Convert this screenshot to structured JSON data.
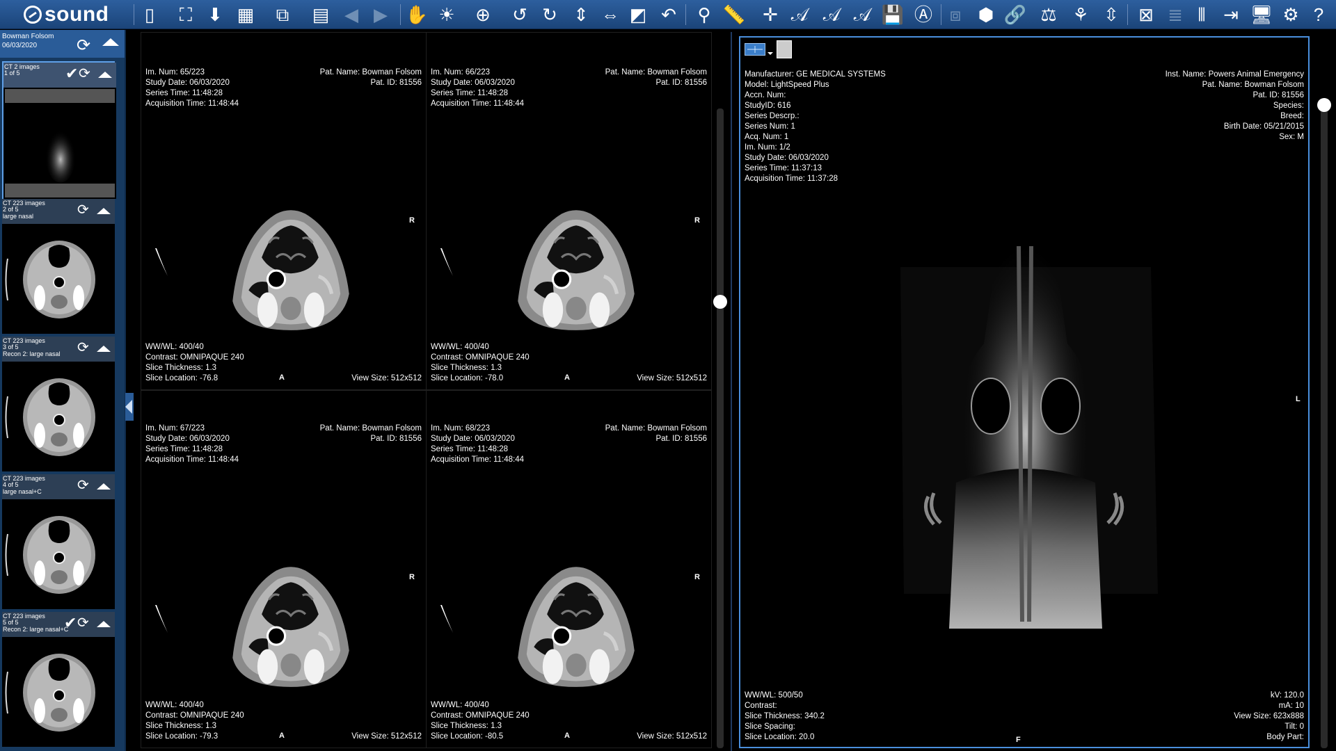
{
  "app": {
    "logo_text": "sound",
    "logo_mark": "sound-logo-mark"
  },
  "toolbar": {
    "icons": [
      "layout-1x1-icon",
      "fit-screen-icon",
      "save-layout-icon",
      "layout-grid-icon",
      "hanging-protocol-icon",
      "report-icon",
      "prev-series-icon",
      "next-series-icon",
      "pan-hand-icon",
      "window-level-icon",
      "zoom-icon",
      "rotate-left-90-icon",
      "rotate-right-90-icon",
      "flip-vertical-icon",
      "flip-horizontal-icon",
      "invert-icon",
      "undo-icon",
      "roi-icon",
      "ruler-icon",
      "crosshair-icon",
      "annotation-text-icon",
      "clear-annotation-icon",
      "clear-all-annotations-icon",
      "save-icon",
      "text-label-icon",
      "mpr-icon",
      "3d-volume-icon",
      "link-series-icon",
      "compare-icon",
      "hide-icon",
      "scroll-sync-icon",
      "clear-viewer-icon",
      "notes-icon",
      "split-view-icon",
      "export-icon",
      "display-icon",
      "settings-icon",
      "help-icon"
    ],
    "rotate_label": "90"
  },
  "study": {
    "patient_name": "Bowman Folsom",
    "date": "06/03/2020"
  },
  "series": [
    {
      "title": "CT 2 images",
      "index": "1 of 5",
      "desc": "",
      "checked": true
    },
    {
      "title": "CT 223 images",
      "index": "2 of 5",
      "desc": "large nasal",
      "checked": false
    },
    {
      "title": "CT 223 images",
      "index": "3 of 5",
      "desc": "Recon 2: large nasal",
      "checked": false
    },
    {
      "title": "CT 223 images",
      "index": "4 of 5",
      "desc": "large nasal+C",
      "checked": false
    },
    {
      "title": "CT 223 images",
      "index": "5 of 5",
      "desc": "Recon 2: large nasal+C",
      "checked": true
    }
  ],
  "viewports": [
    {
      "im_num": "Im. Num: 65/223",
      "study_date": "Study Date: 06/03/2020",
      "series_time": "Series Time: 11:48:28",
      "acq_time": "Acquisition Time: 11:48:44",
      "pat_name": "Pat. Name: Bowman Folsom",
      "pat_id": "Pat. ID: 81556",
      "wwwl": "WW/WL: 400/40",
      "contrast": "Contrast: OMNIPAQUE 240",
      "thickness": "Slice Thickness: 1.3",
      "location": "Slice Location: -76.8",
      "view_size": "View Size: 512x512",
      "ori_right": "R",
      "ori_bottom": "A"
    },
    {
      "im_num": "Im. Num: 66/223",
      "study_date": "Study Date: 06/03/2020",
      "series_time": "Series Time: 11:48:28",
      "acq_time": "Acquisition Time: 11:48:44",
      "pat_name": "Pat. Name: Bowman Folsom",
      "pat_id": "Pat. ID: 81556",
      "wwwl": "WW/WL: 400/40",
      "contrast": "Contrast: OMNIPAQUE 240",
      "thickness": "Slice Thickness: 1.3",
      "location": "Slice Location: -78.0",
      "view_size": "View Size: 512x512",
      "ori_right": "R",
      "ori_bottom": "A"
    },
    {
      "im_num": "Im. Num: 67/223",
      "study_date": "Study Date: 06/03/2020",
      "series_time": "Series Time: 11:48:28",
      "acq_time": "Acquisition Time: 11:48:44",
      "pat_name": "Pat. Name: Bowman Folsom",
      "pat_id": "Pat. ID: 81556",
      "wwwl": "WW/WL: 400/40",
      "contrast": "Contrast: OMNIPAQUE 240",
      "thickness": "Slice Thickness: 1.3",
      "location": "Slice Location: -79.3",
      "view_size": "View Size: 512x512",
      "ori_right": "R",
      "ori_bottom": "A"
    },
    {
      "im_num": "Im. Num: 68/223",
      "study_date": "Study Date: 06/03/2020",
      "series_time": "Series Time: 11:48:28",
      "acq_time": "Acquisition Time: 11:48:44",
      "pat_name": "Pat. Name: Bowman Folsom",
      "pat_id": "Pat. ID: 81556",
      "wwwl": "WW/WL: 400/40",
      "contrast": "Contrast: OMNIPAQUE 240",
      "thickness": "Slice Thickness: 1.3",
      "location": "Slice Location: -80.5",
      "view_size": "View Size: 512x512",
      "ori_right": "R",
      "ori_bottom": "A"
    }
  ],
  "right_viewer": {
    "top_left": [
      "Manufacturer: GE MEDICAL SYSTEMS",
      "Model: LightSpeed Plus",
      "Accn. Num:",
      "StudyID: 616",
      "Series Descrp.:",
      "Series Num: 1",
      "Acq. Num: 1",
      "Im. Num: 1/2",
      "Study Date: 06/03/2020",
      "Series Time: 11:37:13",
      "Acquisition Time: 11:37:28"
    ],
    "top_right": [
      "Inst. Name: Powers Animal Emergency",
      "Pat. Name: Bowman Folsom",
      "Pat. ID: 81556",
      "Species:",
      "Breed:",
      "Birth Date: 05/21/2015",
      "Sex: M"
    ],
    "bottom_left": [
      "WW/WL: 500/50",
      "Contrast:",
      "Slice Thickness: 340.2",
      "Slice Spacing:",
      "Slice Location: 20.0"
    ],
    "bottom_right": [
      "kV: 120.0",
      "mA: 10",
      "View Size: 623x888",
      "Tilt: 0",
      "Body Part:"
    ],
    "ori_right": "L",
    "ori_bottom": "F"
  },
  "colors": {
    "toolbar": "#1b4479",
    "panel": "#16395f",
    "active_border": "#4a8fdc"
  }
}
